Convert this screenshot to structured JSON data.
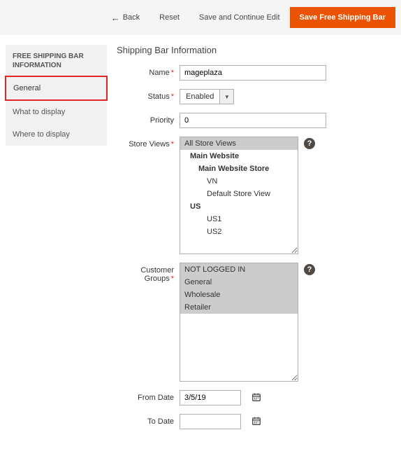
{
  "topbar": {
    "back": "Back",
    "reset": "Reset",
    "save_continue": "Save and Continue Edit",
    "save": "Save Free Shipping Bar"
  },
  "sidebar": {
    "title": "FREE SHIPPING BAR INFORMATION",
    "items": [
      {
        "label": "General"
      },
      {
        "label": "What to display"
      },
      {
        "label": "Where to display"
      }
    ]
  },
  "section_title": "Shipping Bar Information",
  "fields": {
    "name": {
      "label": "Name",
      "value": "mageplaza"
    },
    "status": {
      "label": "Status",
      "value": "Enabled"
    },
    "priority": {
      "label": "Priority",
      "value": "0"
    },
    "store_views": {
      "label": "Store Views",
      "options": [
        {
          "label": "All Store Views",
          "selected": true,
          "indent": 0
        },
        {
          "label": "Main Website",
          "indent": 1,
          "bold": true
        },
        {
          "label": "Main Website Store",
          "indent": 2,
          "bold": true
        },
        {
          "label": "VN",
          "indent": 3
        },
        {
          "label": "Default Store View",
          "indent": 3
        },
        {
          "label": "US",
          "indent": 1,
          "bold": true
        },
        {
          "label": "US1",
          "indent": 3
        },
        {
          "label": "US2",
          "indent": 3
        }
      ]
    },
    "customer_groups": {
      "label": "Customer Groups",
      "options": [
        {
          "label": "NOT LOGGED IN",
          "selected": true
        },
        {
          "label": "General",
          "selected": true
        },
        {
          "label": "Wholesale",
          "selected": true
        },
        {
          "label": "Retailer",
          "selected": true
        }
      ]
    },
    "from_date": {
      "label": "From Date",
      "value": "3/5/19"
    },
    "to_date": {
      "label": "To Date",
      "value": ""
    }
  },
  "glyphs": {
    "help": "?",
    "calendar": "📅",
    "caret": "▼",
    "arrow_left": "←"
  }
}
